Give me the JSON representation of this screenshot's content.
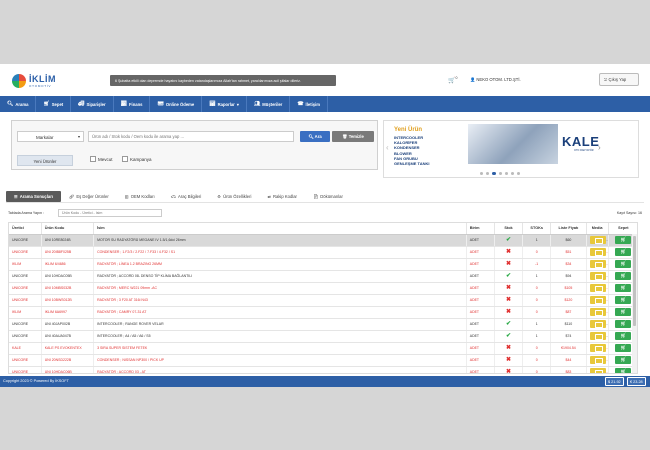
{
  "header": {
    "logo_text": "İKLİM",
    "logo_sub": "OTOMOTİV",
    "announcement": "6 Şubatta etkili olan depremde hayatını kaybeden vatandaşlarımıza Allah'tan rahmet, yaralılarımıza acil şifalar dileriz.",
    "cart_count": "0",
    "user_name": "NEKO OTOM. LTD.ŞTİ.",
    "logout_label": "Çıkış Yap"
  },
  "nav": {
    "items": [
      {
        "label": "Arama",
        "icon": "search-icon"
      },
      {
        "label": "Sepet",
        "icon": "cart-icon"
      },
      {
        "label": "Siparişler",
        "icon": "orders-icon"
      },
      {
        "label": "Finans",
        "icon": "finance-icon"
      },
      {
        "label": "Online Ödeme",
        "icon": "card-icon"
      },
      {
        "label": "Raporlar",
        "icon": "reports-icon"
      },
      {
        "label": "Müşteriler",
        "icon": "users-icon"
      },
      {
        "label": "İletişim",
        "icon": "phone-icon"
      }
    ]
  },
  "search": {
    "brand_select": "Markalar",
    "input_placeholder": "Ürün adı / Stok kodu / Oem kodu ile arama yap ...",
    "ara_label": "Ara",
    "temizle_label": "Temizle",
    "yeni_urunler_label": "Yeni Ürünler",
    "mevcut_label": "Mevcut",
    "kampanya_label": "Kampanya"
  },
  "banner": {
    "title": "Yeni Ürün",
    "lines": [
      "INTERCOOLER",
      "KALORİFER",
      "KONDENSER",
      "BLOWER",
      "FAN GRUBU",
      "GENLEŞME TANKI"
    ],
    "brand": "KALE",
    "brand_sub": "OTO RADYATÖR",
    "dot_count": 7,
    "active_dot": 2
  },
  "tabs": [
    {
      "label": "Arama Sonuçları",
      "icon": "list-icon",
      "active": true
    },
    {
      "label": "Eş Değer Ürünler",
      "icon": "link-icon",
      "active": false
    },
    {
      "label": "OEM Kodları",
      "icon": "barcode-icon",
      "active": false
    },
    {
      "label": "Araç Bilgileri",
      "icon": "car-icon",
      "active": false
    },
    {
      "label": "Ürün Özellikleri",
      "icon": "gear-icon",
      "active": false
    },
    {
      "label": "Rakip Kodlar",
      "icon": "swap-icon",
      "active": false
    },
    {
      "label": "Dökümanlar",
      "icon": "document-icon",
      "active": false
    }
  ],
  "filter": {
    "label": "Tablada Arama Yapın :",
    "placeholder": "Ürün Kodu - Üretici - İsim",
    "count": "Kayıt Sayısı: 16"
  },
  "table": {
    "columns": [
      "Üretici",
      "Ürün Kodu",
      "İsim",
      "Birim",
      "Stok",
      "STOKs",
      "Liste Fiyatı",
      "Media",
      "Sepet"
    ],
    "rows": [
      {
        "uretici": "UNICORE",
        "kod": "UNI 10RE8024B",
        "isim": "MOTOR SU RADYATÖRÜ MEGANE IV 1.5/1,6dci 26mm",
        "birim": "ADET",
        "stok": true,
        "stoks": "1",
        "fiyat": "$60",
        "color": "dark",
        "selected": true
      },
      {
        "uretici": "UNICORE",
        "kod": "UNI 20IB8F025B",
        "isim": "CONDENSER ; 1.F2/3 / 2.F22 / 7.F33 / 4.F32 / S1",
        "birim": "ADET",
        "stok": false,
        "stoks": "0",
        "fiyat": "$51",
        "color": "red",
        "selected": false
      },
      {
        "uretici": "IKLIM",
        "kod": "IKLIM 6/4686",
        "isim": "RADYATÖR ; LİNEA 1.2 BRAZING 26MM",
        "birim": "ADET",
        "stok": false,
        "stoks": "-1",
        "fiyat": "$34",
        "color": "red",
        "selected": false
      },
      {
        "uretici": "UNICORE",
        "kod": "UNI 10HDAC05B",
        "isim": "RADYATÖR ; ACCORD 08- DENSO TİP KLİMA BAĞLANTILI",
        "birim": "ADET",
        "stok": true,
        "stoks": "1",
        "fiyat": "$94",
        "color": "dark",
        "selected": false
      },
      {
        "uretici": "UNICORE",
        "kod": "UNI 10MBS032B",
        "isim": "RADYATÖR ; MERC W221 09mm -AC",
        "birim": "ADET",
        "stok": false,
        "stoks": "0",
        "fiyat": "$105",
        "color": "red",
        "selected": false
      },
      {
        "uretici": "UNICORE",
        "kod": "UNI 10BWS012B",
        "isim": "RADYATÖR ; 3 F20 AT 316i N43",
        "birim": "ADET",
        "stok": false,
        "stoks": "0",
        "fiyat": "$120",
        "color": "red",
        "selected": false
      },
      {
        "uretici": "IKLIM",
        "kod": "IKLIM 6A6997",
        "isim": "RADYATÖR ; CAMRY 07-31 AT",
        "birim": "ADET",
        "stok": false,
        "stoks": "0",
        "fiyat": "$87",
        "color": "red",
        "selected": false
      },
      {
        "uretici": "UNICORE",
        "kod": "UNI 40JAP002B",
        "isim": "INTERCOOLER ; RANGE ROVER VELAR",
        "birim": "ADET",
        "stok": true,
        "stoks": "1",
        "fiyat": "$110",
        "color": "dark",
        "selected": false
      },
      {
        "uretici": "UNICORE",
        "kod": "UNI 40AUA047B",
        "isim": "INTERCOOLER ; A4 / A5 / A6 / S5",
        "birim": "ADET",
        "stok": true,
        "stoks": "1",
        "fiyat": "$74",
        "color": "dark",
        "selected": false
      },
      {
        "uretici": "KALE",
        "kod": "KALE PS EVOKENTEX",
        "isim": "3 SIRA SUPER SISTEM FETEK",
        "birim": "ADET",
        "stok": false,
        "stoks": "0",
        "fiyat": "€1904.54",
        "color": "red",
        "selected": false
      },
      {
        "uretici": "UNICORE",
        "kod": "UNI 20NSD222B",
        "isim": "CONDENSER ; NISSAN NP300 / PICK UP",
        "birim": "ADET",
        "stok": false,
        "stoks": "0",
        "fiyat": "$44",
        "color": "red",
        "selected": false
      },
      {
        "uretici": "UNICORE",
        "kod": "UNI 10HDAC06B",
        "isim": "RADYATÖR ; ACCORD 03 - AT",
        "birim": "ADET",
        "stok": false,
        "stoks": "0",
        "fiyat": "$83",
        "color": "red",
        "selected": false
      }
    ]
  },
  "footer": {
    "copyright": "Copyright 2023 © Powered By İKSOFT",
    "usd": "$ 21.92",
    "eur": "€ 23.28"
  }
}
